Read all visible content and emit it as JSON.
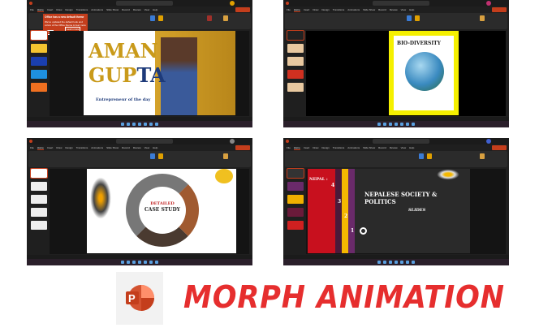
{
  "ribbon_tabs": [
    "File",
    "Home",
    "Insert",
    "Draw",
    "Design",
    "Transitions",
    "Animations",
    "Slide Show",
    "Record",
    "Review",
    "View",
    "Help"
  ],
  "panel1": {
    "popup_title": "Office has a new default theme",
    "popup_body": "We've updated the default look and colors of the Office theme to feel more modern and refreshed.",
    "popup_learn": "Learn more",
    "popup_gotit": "Got it",
    "title1": "AMAN",
    "title2a": "GUP",
    "title2b": "TA",
    "subtitle": "Entrepreneur of the day"
  },
  "panel2": {
    "title": "BIO-DIVERSITY"
  },
  "panel3": {
    "line1": "DETAILED",
    "line2": "CASE STUDY"
  },
  "panel4": {
    "heading": "NEPALESE SOCIETY & POLITICS",
    "side_title": "NEPAL :",
    "steps": [
      "4",
      "3",
      "2",
      "1"
    ],
    "brand": "SLIDES"
  },
  "caption": "MORPH ANIMATION",
  "logo_letter": "P",
  "colors": {
    "accent": "#c43e1c",
    "caption": "#e62e2e",
    "gold": "#c99a1a"
  }
}
